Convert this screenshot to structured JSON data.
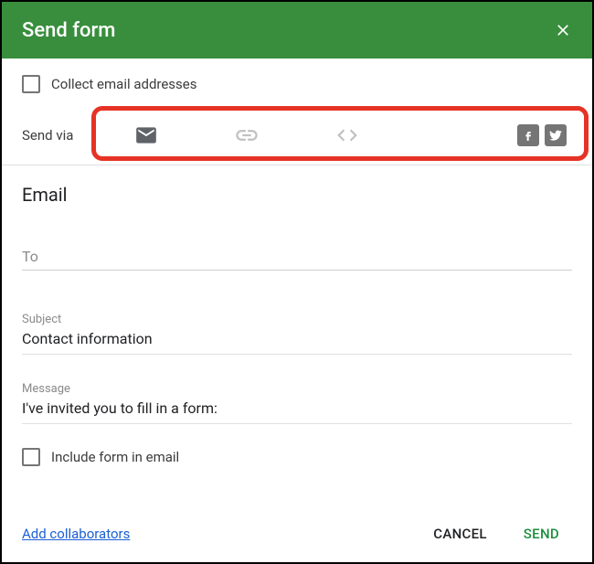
{
  "header": {
    "title": "Send form"
  },
  "collect": {
    "label": "Collect email addresses"
  },
  "sendvia": {
    "label": "Send via"
  },
  "email": {
    "heading": "Email",
    "to_label": "To",
    "to_value": "",
    "subject_label": "Subject",
    "subject_value": "Contact information",
    "message_label": "Message",
    "message_value": "I've invited you to fill in a form:"
  },
  "include": {
    "label": "Include form in email"
  },
  "footer": {
    "add_collab": "Add collaborators",
    "cancel": "CANCEL",
    "send": "SEND"
  }
}
